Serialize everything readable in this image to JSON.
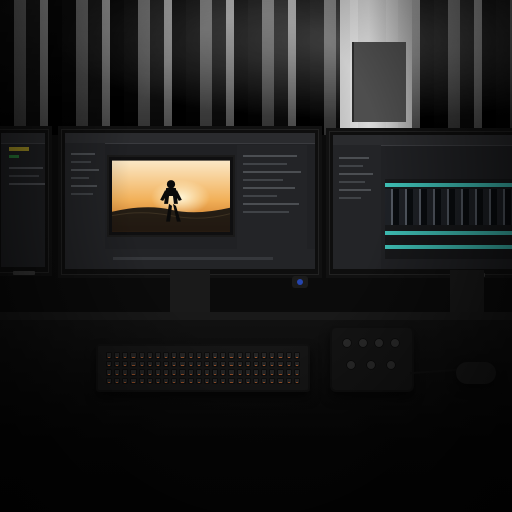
{
  "scene": {
    "accent_colors": {
      "sunset_sky_top": "#fbe8c6",
      "sunset_sky_mid": "#f2b15a",
      "sunset_sky_bottom": "#c56b1b",
      "timeline_track": "#43d0c5",
      "keyboard_backlight": "#ff7a2f",
      "ui_yellow": "#d8c027",
      "ui_green": "#2ea043"
    },
    "icons": {
      "webcam": "webcam-icon",
      "mouse": "mouse-icon"
    }
  }
}
